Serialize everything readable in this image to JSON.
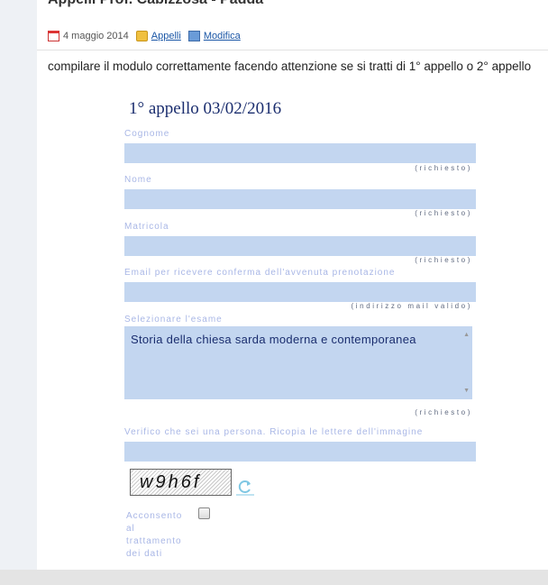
{
  "post": {
    "title": "Appelli Prof. Cabizzosa - Padda",
    "date": "4 maggio 2014",
    "category_link": "Appelli",
    "edit_link": "Modifica"
  },
  "intro": "compilare il modulo correttamente facendo attenzione se si tratti di 1° appello o 2° appello",
  "form": {
    "title": "1° appello 03/02/2016",
    "fields": {
      "cognome": {
        "label": "Cognome",
        "note": "(richiesto)",
        "value": ""
      },
      "nome": {
        "label": "Nome",
        "note": "(richiesto)",
        "value": ""
      },
      "matricola": {
        "label": "Matricola",
        "note": "(richiesto)",
        "value": ""
      },
      "email": {
        "label": "Email per ricevere conferma dell'avvenuta prenotazione",
        "note": "(indirizzo mail valido)",
        "value": ""
      },
      "esame": {
        "label": "Selezionare l'esame",
        "note": "(richiesto)",
        "value": "Storia della chiesa sarda moderna e contemporanea"
      },
      "captcha": {
        "label": "Verifico che sei una persona. Ricopia le lettere dell'immagine",
        "value": ""
      }
    },
    "captcha_text": "w9h6f",
    "consent_label": "Acconsento al trattamento dei dati",
    "consent_checked": false
  },
  "icons": {
    "date": "calendar-icon",
    "category": "folder-icon",
    "edit": "edit-icon",
    "refresh": "refresh-icon"
  }
}
